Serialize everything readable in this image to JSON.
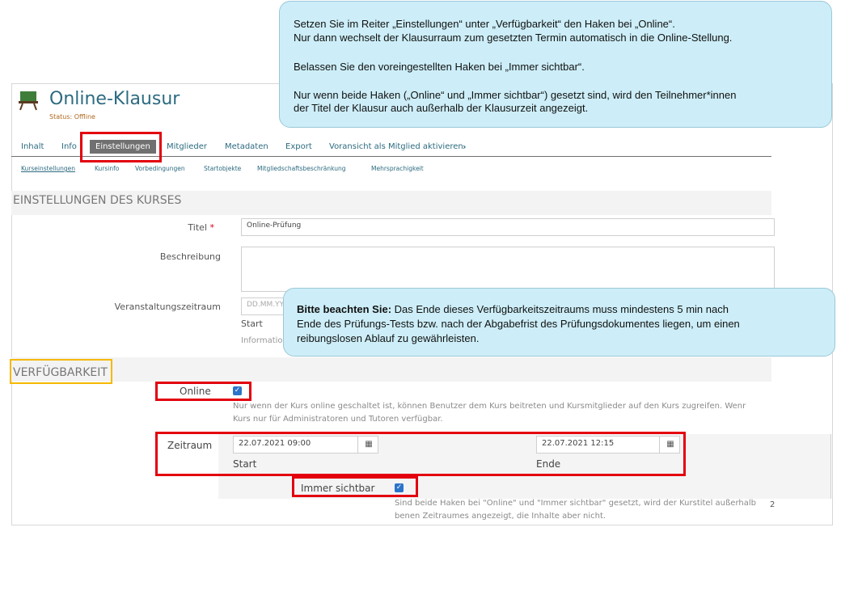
{
  "header": {
    "course_title": "Online-Klausur",
    "status": "Status: Offline"
  },
  "tabs": [
    "Inhalt",
    "Info",
    "Einstellungen",
    "Mitglieder",
    "Metadaten",
    "Export",
    "Voransicht als Mitglied aktivieren"
  ],
  "subtabs": [
    "Kurseinstellungen",
    "Kursinfo",
    "Vorbedingungen",
    "Startobjekte",
    "Mitgliedschaftsbeschränkung",
    "Mehrsprachigkeit"
  ],
  "section_course": {
    "heading": "EINSTELLUNGEN DES KURSES",
    "title_label": "Titel",
    "required_mark": "*",
    "title_value": "Online-Prüfung",
    "description_label": "Beschreibung",
    "period_label": "Veranstaltungszeitraum",
    "period_placeholder": "DD.MM.YY",
    "period_start_label": "Start",
    "period_info": "Information"
  },
  "section_availability": {
    "heading": "VERFÜGBARKEIT",
    "online_label": "Online",
    "online_checked": true,
    "online_help_1": "Nur wenn der Kurs online geschaltet ist, können Benutzer dem Kurs beitreten und Kursmitglieder auf den Kurs zugreifen. Wenr",
    "online_help_2": "Kurs nur für Administratoren und Tutoren verfügbar.",
    "period_label": "Zeitraum",
    "start_value": "22.07.2021 09:00",
    "end_value": "22.07.2021 12:15",
    "start_label": "Start",
    "end_label": "Ende",
    "visible_label": "Immer sichtbar",
    "visible_checked": true,
    "visible_help_1": "Sind beide Haken bei \"Online\" und \"Immer sichtbar\" gesetzt, wird der Kurstitel außerhalb",
    "visible_help_2": "benen Zeitraumes angezeigt, die Inhalte aber nicht.",
    "page_number": "2"
  },
  "callout_top": {
    "line1": "Setzen Sie im Reiter „Einstellungen“ unter „Verfügbarkeit“ den Haken bei „Online“.",
    "line2": "Nur dann wechselt der Klausurraum zum gesetzten Termin automatisch in die Online-Stellung.",
    "line3": "Belassen Sie den voreingestellten Haken bei „Immer sichtbar“.",
    "line4": "Nur wenn beide Haken („Online“ und „Immer sichtbar“) gesetzt sind, wird den Teilnehmer*innen",
    "line5": "der Titel der Klausur auch außerhalb der Klausurzeit angezeigt."
  },
  "callout_mid": {
    "bold": "Bitte beachten Sie:",
    "text1": " Das Ende dieses Verfügbarkeitszeitraums muss mindestens 5 min nach",
    "text2": "Ende des Prüfungs-Tests bzw. nach der Abgabefrist des Prüfungsdokumentes liegen, um einen",
    "text3": "reibungslosen Ablauf zu gewährleisten."
  },
  "icons": {
    "course_icon": "easel-icon",
    "calendar": "calendar-icon",
    "chevron": "chevron-right-icon"
  },
  "colors": {
    "accent": "#2d6b80",
    "status": "#b06820",
    "highlight_red": "#e3000f",
    "highlight_yellow": "#f5b800",
    "callout_bg": "#cdeef8",
    "checkbox": "#2c74c9"
  }
}
